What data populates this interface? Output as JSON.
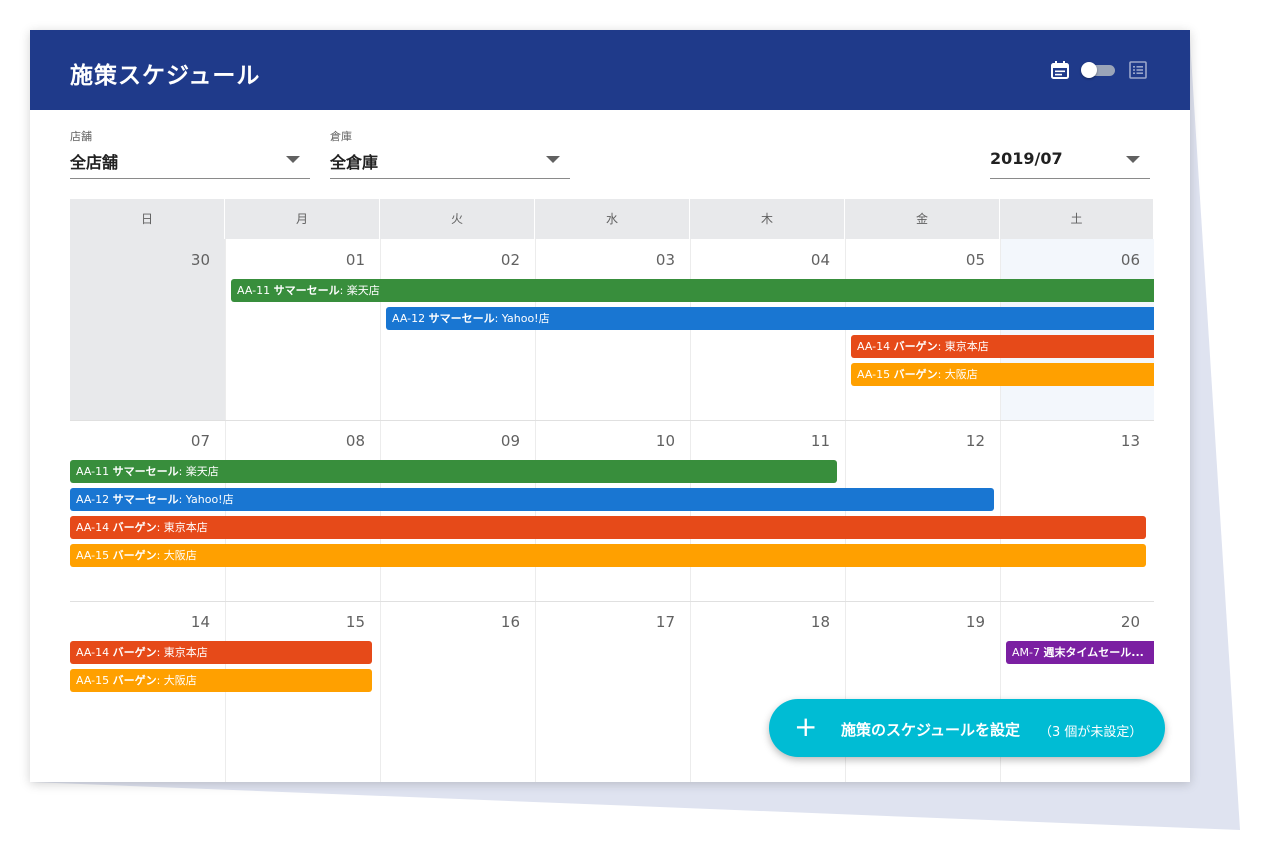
{
  "app": {
    "title": "施策スケジュール",
    "icons": [
      "calendar-view-icon",
      "toggle-switch",
      "list-view-icon"
    ],
    "colors": {
      "appbar": "#1f3a8a",
      "fab": "#00bcd4"
    }
  },
  "filters": {
    "store": {
      "label": "店舗",
      "value": "全店舗"
    },
    "warehouse": {
      "label": "倉庫",
      "value": "全倉庫"
    },
    "month": {
      "label": "",
      "value": "2019/07"
    }
  },
  "calendar": {
    "weekdays": [
      "日",
      "月",
      "火",
      "水",
      "木",
      "金",
      "土"
    ],
    "weeks": [
      [
        "30",
        "01",
        "02",
        "03",
        "04",
        "05",
        "06"
      ],
      [
        "07",
        "08",
        "09",
        "10",
        "11",
        "12",
        "13"
      ],
      [
        "14",
        "15",
        "16",
        "17",
        "18",
        "19",
        "20"
      ]
    ],
    "events": [
      {
        "week": 0,
        "start": 1,
        "end": 7,
        "row": 0,
        "code": "AA-11",
        "name": "サマーセール",
        "place": ": 楽天店",
        "color": "#388e3c"
      },
      {
        "week": 0,
        "start": 2,
        "end": 7,
        "row": 1,
        "code": "AA-12",
        "name": "サマーセール",
        "place": ": Yahoo!店",
        "color": "#1976d2"
      },
      {
        "week": 0,
        "start": 5,
        "end": 7,
        "row": 2,
        "code": "AA-14",
        "name": "バーゲン",
        "place": ": 東京本店",
        "color": "#e64a19"
      },
      {
        "week": 0,
        "start": 5,
        "end": 7,
        "row": 3,
        "code": "AA-15",
        "name": "バーゲン",
        "place": ": 大阪店",
        "color": "#ffa000"
      },
      {
        "week": 1,
        "start": 0,
        "end": 5,
        "row": 0,
        "code": "AA-11",
        "name": "サマーセール",
        "place": ": 楽天店",
        "color": "#388e3c"
      },
      {
        "week": 1,
        "start": 0,
        "end": 6,
        "row": 1,
        "code": "AA-12",
        "name": "サマーセール",
        "place": ": Yahoo!店",
        "color": "#1976d2"
      },
      {
        "week": 1,
        "start": 0,
        "end": 7,
        "row": 2,
        "code": "AA-14",
        "name": "バーゲン",
        "place": ": 東京本店",
        "color": "#e64a19"
      },
      {
        "week": 1,
        "start": 0,
        "end": 7,
        "row": 3,
        "code": "AA-15",
        "name": "バーゲン",
        "place": ": 大阪店",
        "color": "#ffa000"
      },
      {
        "week": 2,
        "start": 0,
        "end": 2,
        "row": 0,
        "code": "AA-14",
        "name": "バーゲン",
        "place": ": 東京本店",
        "color": "#e64a19"
      },
      {
        "week": 2,
        "start": 0,
        "end": 2,
        "row": 1,
        "code": "AA-15",
        "name": "バーゲン",
        "place": ": 大阪店",
        "color": "#ffa000"
      },
      {
        "week": 2,
        "start": 6,
        "end": 7,
        "row": 0,
        "code": "AM-7",
        "name": "週末タイムセール...",
        "place": "",
        "color": "#7b1fa2"
      }
    ]
  },
  "fab": {
    "icon": "plus-icon",
    "label": "施策のスケジュールを設定",
    "sub": "（3 個が未設定）"
  }
}
